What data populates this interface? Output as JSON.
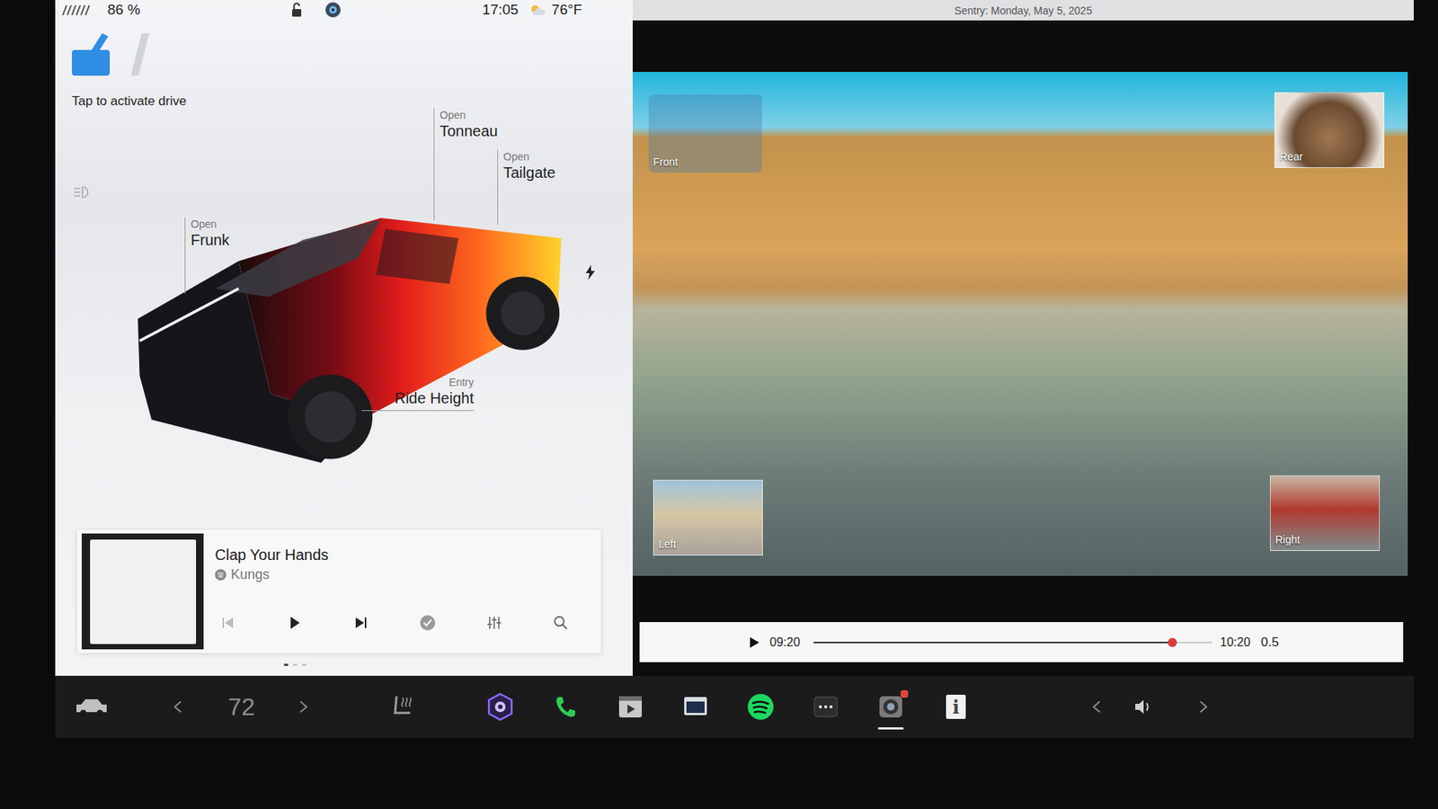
{
  "status_bar": {
    "battery": "86 %",
    "time": "17:05",
    "temperature": "76°F",
    "locked": false
  },
  "drive": {
    "label": "Tap to activate drive"
  },
  "vehicle_controls": [
    {
      "action": "Open",
      "label": "Tonneau"
    },
    {
      "action": "Open",
      "label": "Tailgate"
    },
    {
      "action": "Open",
      "label": "Frunk"
    },
    {
      "action": "Entry",
      "label": "Ride Height"
    }
  ],
  "media": {
    "title": "Clap Your Hands",
    "artist": "Kungs",
    "playing": false,
    "pages": [
      {
        "selected": true
      },
      {
        "selected": false
      },
      {
        "selected": false
      }
    ]
  },
  "sentry": {
    "title": "Sentry: Monday, May 5, 2025",
    "cameras": [
      {
        "label": "Front",
        "selected": true
      },
      {
        "label": "Rear",
        "selected": false
      },
      {
        "label": "Left",
        "selected": false
      },
      {
        "label": "Right",
        "selected": false
      }
    ],
    "player": {
      "playing": false,
      "current": "09:20",
      "end": "10:20",
      "level": 0.9,
      "speed": "0.5"
    }
  },
  "dock": {
    "cabin_temperature": "72",
    "apps": [
      {
        "kind": "camera",
        "selected": false,
        "badge": false
      },
      {
        "kind": "phone",
        "selected": false,
        "badge": false
      },
      {
        "kind": "video",
        "selected": false,
        "badge": false
      },
      {
        "kind": "screen",
        "selected": false,
        "badge": false
      },
      {
        "kind": "spotify",
        "selected": false,
        "badge": false
      },
      {
        "kind": "more",
        "selected": false,
        "badge": false
      },
      {
        "kind": "dashcam",
        "selected": true,
        "badge": true
      },
      {
        "kind": "manual",
        "selected": false,
        "badge": false,
        "glyph": "i"
      }
    ]
  }
}
